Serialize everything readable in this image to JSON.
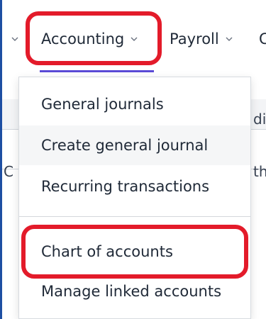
{
  "nav": {
    "items": [
      {
        "label": "Accounting"
      },
      {
        "label": "Payroll"
      },
      {
        "label": "C"
      }
    ]
  },
  "background": {
    "partial_texts": [
      "di",
      "th",
      "C"
    ]
  },
  "menu": {
    "items": [
      {
        "label": "General journals"
      },
      {
        "label": "Create general journal"
      },
      {
        "label": "Recurring transactions"
      },
      {
        "label": "Chart of accounts"
      },
      {
        "label": "Manage linked accounts"
      }
    ]
  },
  "colors": {
    "highlight": "#e31b2a",
    "active_underline": "#5b4bd6",
    "frame": "#1e4fa3"
  }
}
